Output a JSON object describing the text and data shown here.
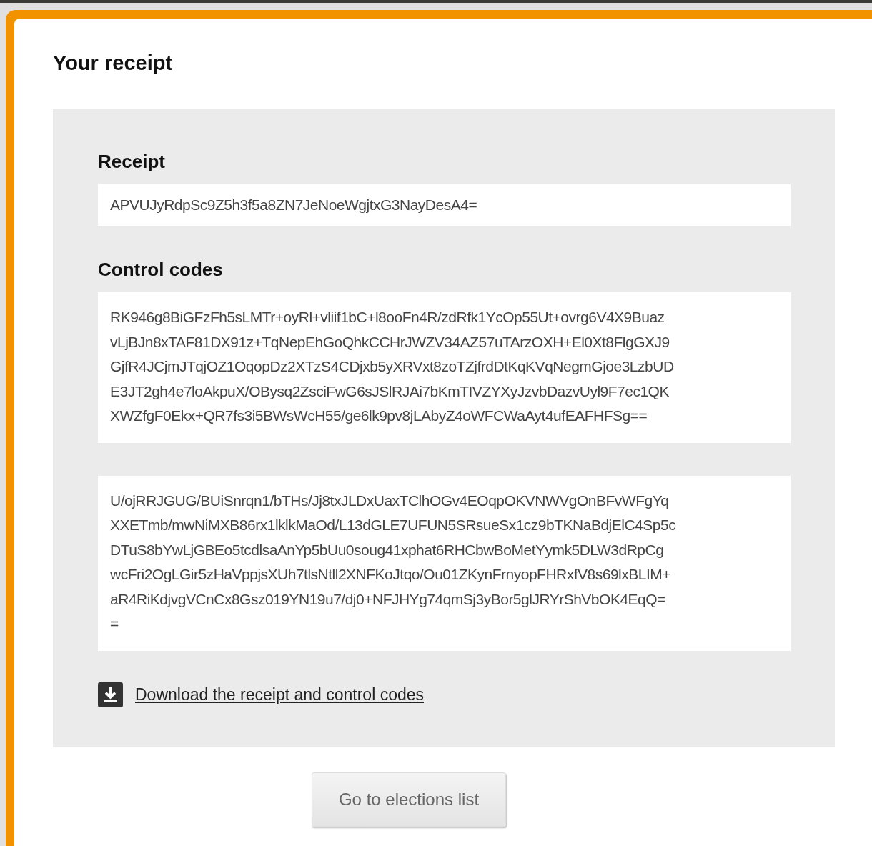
{
  "title": "Your receipt",
  "receipt": {
    "label": "Receipt",
    "value": "APVUJyRdpSc9Z5h3f5a8ZN7JeNoeWgjtxG3NayDesA4="
  },
  "control_codes": {
    "label": "Control codes",
    "codes": [
      {
        "lines": [
          "RK946g8BiGFzFh5sLMTr+oyRl+vliif1bC+l8ooFn4R/zdRfk1YcOp55Ut+ovrg6V4X9Buaz",
          "vLjBJn8xTAF81DX91z+TqNepEhGoQhkCCHrJWZV34AZ57uTArzOXH+El0Xt8FlgGXJ9",
          "GjfR4JCjmJTqjOZ1OqopDz2XTzS4CDjxb5yXRVxt8zoTZjfrdDtKqKVqNegmGjoe3LzbUD",
          "E3JT2gh4e7loAkpuX/OBysq2ZsciFwG6sJSlRJAi7bKmTIVZYXyJzvbDazvUyl9F7ec1QK",
          "XWZfgF0Ekx+QR7fs3i5BWsWcH55/ge6lk9pv8jLAbyZ4oWFCWaAyt4ufEAFHFSg=="
        ]
      },
      {
        "lines": [
          "U/ojRRJGUG/BUiSnrqn1/bTHs/Jj8txJLDxUaxTClhOGv4EOqpOKVNWVgOnBFvWFgYq",
          "XXETmb/mwNiMXB86rx1lklkMaOd/L13dGLE7UFUN5SRsueSx1cz9bTKNaBdjElC4Sp5c",
          "DTuS8bYwLjGBEo5tcdlsaAnYp5bUu0soug41xphat6RHCbwBoMetYymk5DLW3dRpCg",
          "wcFri2OgLGir5zHaVppjsXUh7tlsNtll2XNFKoJtqo/Ou01ZKynFrnyopFHRxfV8s69lxBLIM+",
          "aR4RiKdjvgVCnCx8Gsz019YN19u7/dj0+NFJHYg74qmSj3yBor5glJRYrShVbOK4EqQ=",
          "="
        ]
      }
    ]
  },
  "download_link": "Download the receipt and control codes",
  "button": "Go to elections list"
}
